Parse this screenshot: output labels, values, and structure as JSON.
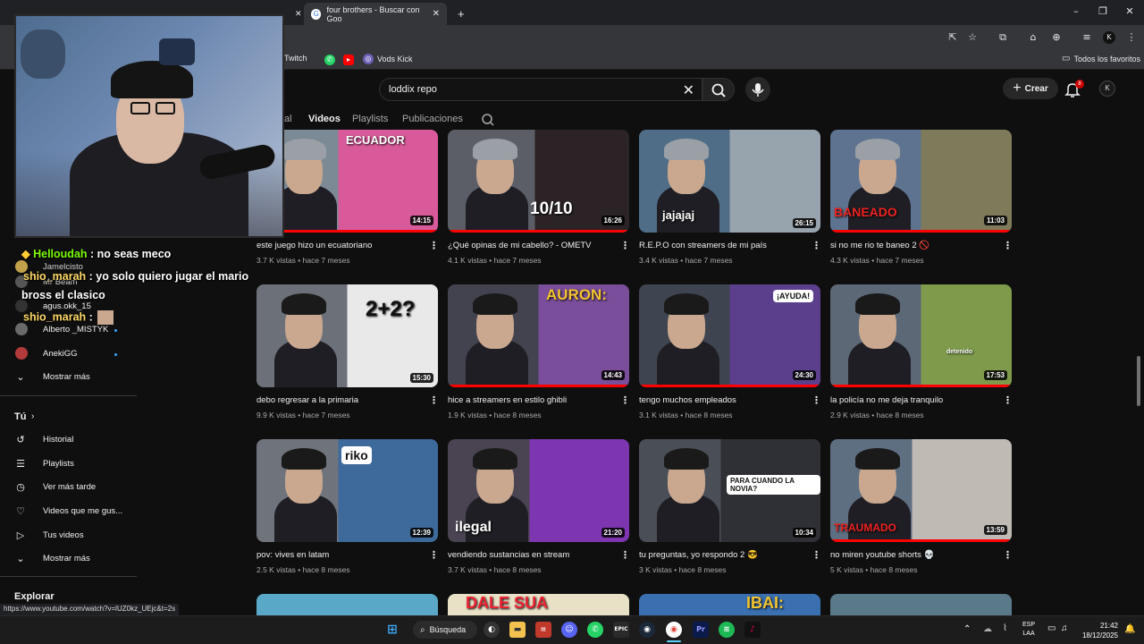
{
  "browser": {
    "active_tab_title": "four brothers - Buscar con Goo",
    "new_tab_label": "+",
    "bookmarks": [
      {
        "label": "Twitch"
      },
      {
        "label": "Vods Kick"
      }
    ],
    "all_favorites_label": "Todos los favoritos",
    "status_url": "https://www.youtube.com/watch?v=lUZ0kz_UEjc&t=2s"
  },
  "youtube": {
    "search_query": "loddix repo",
    "create_label": "Crear",
    "notification_count": "8",
    "avatar_text": "K",
    "channel_tabs": [
      {
        "label": "al"
      },
      {
        "label": "Videos"
      },
      {
        "label": "Playlists"
      },
      {
        "label": "Publicaciones"
      }
    ]
  },
  "sidebar": {
    "subscriptions": [
      {
        "label": "Jamelcisto"
      },
      {
        "label": "Mr Beam"
      },
      {
        "label": "agus.okk_15"
      },
      {
        "label": "Alberto _MISTYK"
      },
      {
        "label": "AnekiGG"
      }
    ],
    "show_more_1": "Mostrar más",
    "you_header": "Tú",
    "you_items": [
      {
        "label": "Historial",
        "icon": "history-icon"
      },
      {
        "label": "Playlists",
        "icon": "playlists-icon"
      },
      {
        "label": "Ver más tarde",
        "icon": "watch-later-icon"
      },
      {
        "label": "Videos que me gus...",
        "icon": "like-icon"
      },
      {
        "label": "Tus videos",
        "icon": "your-videos-icon"
      }
    ],
    "show_more_2": "Mostrar más",
    "explore_header": "Explorar"
  },
  "chat": [
    {
      "user": "Helloudah",
      "text": " : no seas meco"
    },
    {
      "user": "shio_marah",
      "text": " : yo solo quiero jugar el mario"
    },
    {
      "user": "",
      "text": "bross el clasico"
    },
    {
      "user": "shio_marah",
      "text": " :"
    }
  ],
  "videos": [
    {
      "title": "este juego hizo un ecuatoriano",
      "meta": "3.7 K vistas • hace 7 meses",
      "duration": "14:15",
      "progress": 1.0,
      "overlay": "ECUADOR"
    },
    {
      "title": "¿Qué opinas de mi cabello? - OMETV",
      "meta": "4.1 K vistas • hace 7 meses",
      "duration": "16:26",
      "progress": 1.0,
      "overlay": "10/10"
    },
    {
      "title": "R.E.P.O con streamers de mi país",
      "meta": "3.4 K vistas • hace 7 meses",
      "duration": "26:15",
      "progress": 0.0,
      "overlay": "jajajaj"
    },
    {
      "title": "si no me rio te baneo 2 🚫",
      "meta": "4.3 K vistas • hace 7 meses",
      "duration": "11:03",
      "progress": 1.0,
      "overlay": "BANEADO"
    },
    {
      "title": "debo regresar a la primaria",
      "meta": "9.9 K vistas • hace 7 meses",
      "duration": "15:30",
      "progress": 0.0,
      "overlay": "2+2?"
    },
    {
      "title": "hice a streamers en estilo ghibli",
      "meta": "1.9 K vistas • hace 8 meses",
      "duration": "14:43",
      "progress": 1.0,
      "overlay": "AURON:"
    },
    {
      "title": "tengo muchos empleados",
      "meta": "3.1 K vistas • hace 8 meses",
      "duration": "24:30",
      "progress": 1.0,
      "overlay": "¡AYUDA!"
    },
    {
      "title": "la policía no me deja tranquilo",
      "meta": "2.9 K vistas • hace 8 meses",
      "duration": "17:53",
      "progress": 1.0,
      "overlay": "detenido"
    },
    {
      "title": "pov: vives en latam",
      "meta": "2.5 K vistas • hace 8 meses",
      "duration": "12:39",
      "progress": 0.0,
      "overlay": "riko"
    },
    {
      "title": "vendiendo sustancias en stream",
      "meta": "3.7 K vistas • hace 8 meses",
      "duration": "21:20",
      "progress": 0.0,
      "overlay": "ilegal"
    },
    {
      "title": "tu preguntas, yo respondo 2 😎",
      "meta": "3 K vistas • hace 8 meses",
      "duration": "10:34",
      "progress": 0.0,
      "overlay": "PARA CUANDO LA NOVIA?"
    },
    {
      "title": "no miren youtube shorts 💀",
      "meta": "5 K vistas • hace 8 meses",
      "duration": "13:59",
      "progress": 1.0,
      "overlay": "TRAUMADO"
    }
  ],
  "next_row_overlays": [
    "DALE SUA",
    "IBAI:"
  ],
  "taskbar": {
    "search_label": "Búsqueda",
    "lang": "ESP",
    "lang2": "LAA",
    "time": "21:42",
    "date": "18/12/2025"
  }
}
